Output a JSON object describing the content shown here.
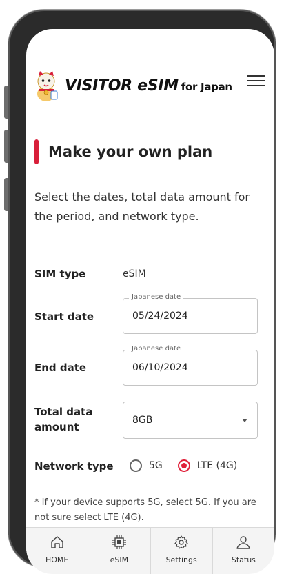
{
  "header": {
    "brand": "VISITOR eSIM",
    "brand_sub": "for Japan",
    "logo_icon": "lucky-cat-mascot-icon",
    "menu_icon": "hamburger-menu-icon"
  },
  "page": {
    "title": "Make your own plan",
    "intro": "Select the dates, total data amount for the period, and network type.",
    "accent_color": "#d81f3a"
  },
  "form": {
    "sim_type_label": "SIM type",
    "sim_type_value": "eSIM",
    "start_date_label": "Start date",
    "start_date_legend": "Japanese date",
    "start_date_value": "05/24/2024",
    "end_date_label": "End date",
    "end_date_legend": "Japanese date",
    "end_date_value": "06/10/2024",
    "data_label": "Total data amount",
    "data_value": "8GB",
    "network_label": "Network type",
    "network_options": [
      {
        "label": "5G",
        "selected": false
      },
      {
        "label": "LTE (4G)",
        "selected": true
      }
    ],
    "note": "* If your device supports 5G, select 5G. If you are not sure select LTE (4G)."
  },
  "bottom_nav": [
    {
      "label": "HOME",
      "icon": "home-icon"
    },
    {
      "label": "eSIM",
      "icon": "chip-icon"
    },
    {
      "label": "Settings",
      "icon": "gear-icon"
    },
    {
      "label": "Status",
      "icon": "user-icon"
    }
  ]
}
